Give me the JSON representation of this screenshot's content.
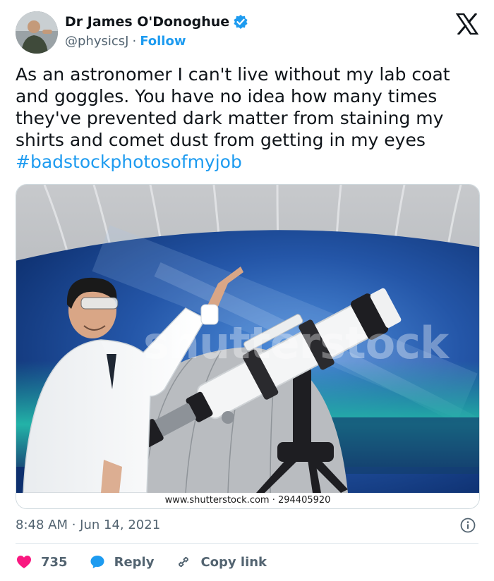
{
  "author": {
    "display_name": "Dr James O'Donoghue",
    "handle": "@physicsJ",
    "separator": "·",
    "follow_label": "Follow"
  },
  "icons": {
    "verified": "verified-badge-icon",
    "logo": "x-logo-icon",
    "info": "info-icon",
    "like": "heart-icon",
    "reply": "reply-bubble-icon",
    "copy_link": "link-icon"
  },
  "tweet": {
    "lines": [
      "As an astronomer I can't live without my lab coat",
      "and goggles. You have no idea how many times",
      "they've prevented dark matter from staining my",
      "shirts and comet dust from getting in my eyes"
    ],
    "hashtag": "#badstockphotosofmyjob"
  },
  "media": {
    "watermark": "shutterstock",
    "credit": "www.shutterstock.com · 294405920"
  },
  "timestamp": "8:48 AM · Jun 14, 2021",
  "actions": {
    "like_count": "735",
    "reply_label": "Reply",
    "copy_link_label": "Copy link"
  },
  "colors": {
    "accent": "#1d9bf0",
    "like": "#f91880",
    "text": "#0f1419",
    "muted": "#536471"
  }
}
